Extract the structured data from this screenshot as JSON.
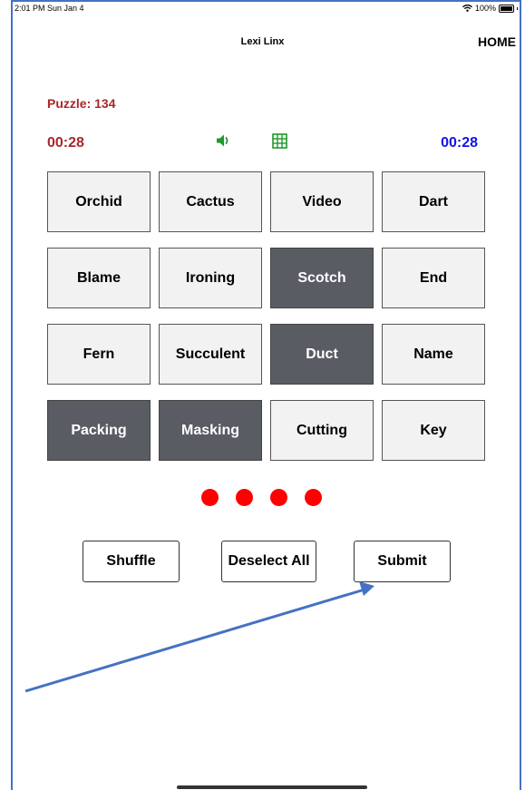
{
  "status_bar": {
    "time": "2:01 PM  Sun Jan 4",
    "battery": "100%"
  },
  "header": {
    "title": "Lexi Linx",
    "home": "HOME"
  },
  "puzzle": {
    "label": "Puzzle: 134"
  },
  "timers": {
    "left": "00:28",
    "right": "00:28"
  },
  "icons": {
    "speaker": "speaker-icon",
    "grid": "grid-icon"
  },
  "colors": {
    "red_text": "#a8282a",
    "blue_text": "#1414e6",
    "icon_green": "#1e9a2a",
    "selected_tile": "#5a5c64",
    "unselected_tile": "#f2f2f2",
    "mistake_dot": "#ff0000",
    "annotation_arrow": "#4472c4"
  },
  "tiles": [
    {
      "label": "Orchid",
      "selected": false
    },
    {
      "label": "Cactus",
      "selected": false
    },
    {
      "label": "Video",
      "selected": false
    },
    {
      "label": "Dart",
      "selected": false
    },
    {
      "label": "Blame",
      "selected": false
    },
    {
      "label": "Ironing",
      "selected": false
    },
    {
      "label": "Scotch",
      "selected": true
    },
    {
      "label": "End",
      "selected": false
    },
    {
      "label": "Fern",
      "selected": false
    },
    {
      "label": "Succulent",
      "selected": false
    },
    {
      "label": "Duct",
      "selected": true
    },
    {
      "label": "Name",
      "selected": false
    },
    {
      "label": "Packing",
      "selected": true
    },
    {
      "label": "Masking",
      "selected": true
    },
    {
      "label": "Cutting",
      "selected": false
    },
    {
      "label": "Key",
      "selected": false
    }
  ],
  "mistakes_remaining": 4,
  "buttons": {
    "shuffle": "Shuffle",
    "deselect": "Deselect All",
    "submit": "Submit"
  }
}
